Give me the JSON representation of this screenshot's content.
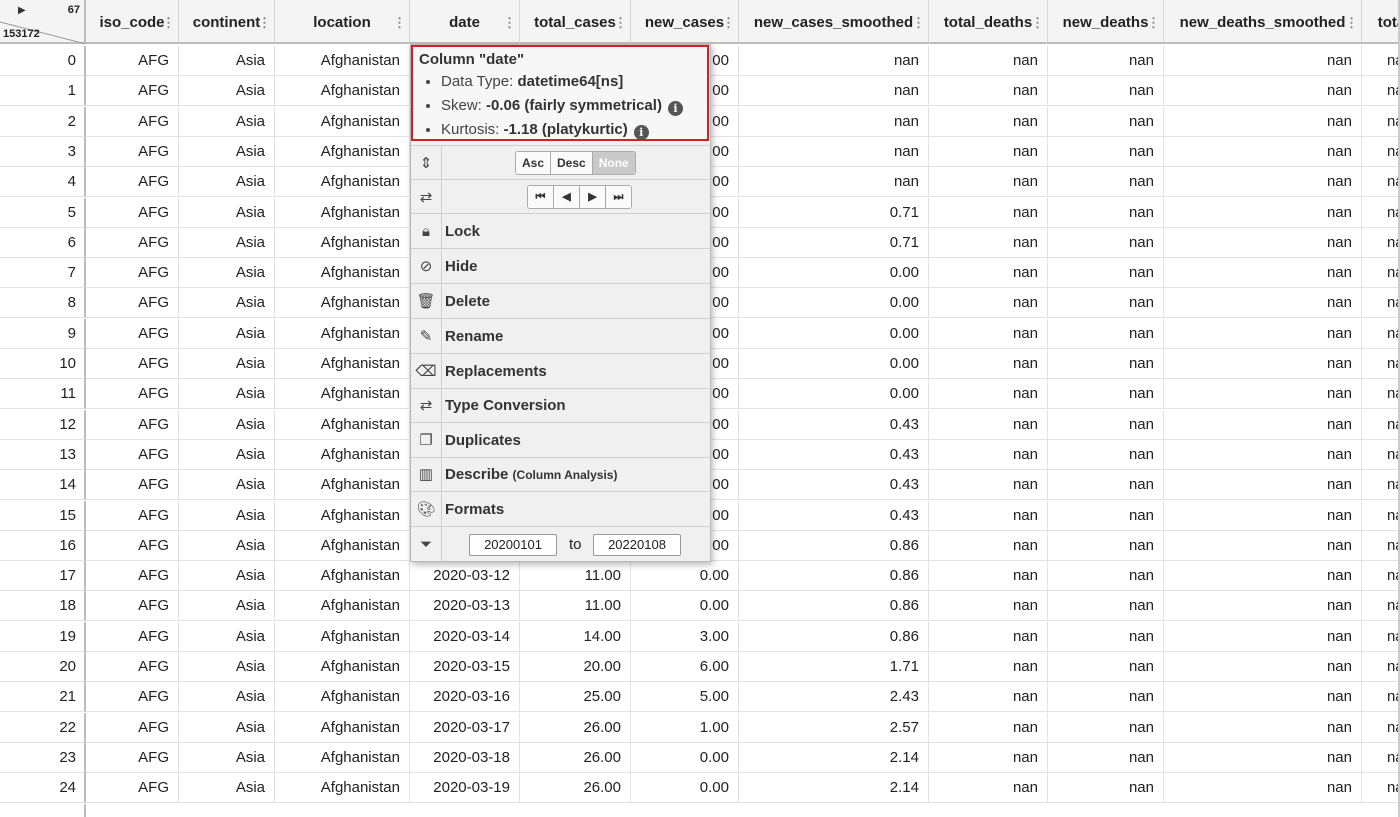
{
  "corner": {
    "col_count": "67",
    "row_count": "153172"
  },
  "columns": [
    "iso_code",
    "continent",
    "location",
    "date",
    "total_cases",
    "new_cases",
    "new_cases_smoothed",
    "total_deaths",
    "new_deaths",
    "new_deaths_smoothed",
    "tota"
  ],
  "rows": [
    {
      "idx": "0",
      "iso": "AFG",
      "cont": "Asia",
      "loc": "Afghanistan",
      "date": "",
      "tc": "",
      "nc": ".00",
      "ncs": "nan",
      "td": "nan",
      "nd": "nan",
      "nds": "nan",
      "t": "nan"
    },
    {
      "idx": "1",
      "iso": "AFG",
      "cont": "Asia",
      "loc": "Afghanistan",
      "date": "",
      "tc": "",
      "nc": ".00",
      "ncs": "nan",
      "td": "nan",
      "nd": "nan",
      "nds": "nan",
      "t": "nan"
    },
    {
      "idx": "2",
      "iso": "AFG",
      "cont": "Asia",
      "loc": "Afghanistan",
      "date": "",
      "tc": "",
      "nc": ".00",
      "ncs": "nan",
      "td": "nan",
      "nd": "nan",
      "nds": "nan",
      "t": "nan"
    },
    {
      "idx": "3",
      "iso": "AFG",
      "cont": "Asia",
      "loc": "Afghanistan",
      "date": "",
      "tc": "",
      "nc": ".00",
      "ncs": "nan",
      "td": "nan",
      "nd": "nan",
      "nds": "nan",
      "t": "nan"
    },
    {
      "idx": "4",
      "iso": "AFG",
      "cont": "Asia",
      "loc": "Afghanistan",
      "date": "",
      "tc": "",
      "nc": ".00",
      "ncs": "nan",
      "td": "nan",
      "nd": "nan",
      "nds": "nan",
      "t": "nan"
    },
    {
      "idx": "5",
      "iso": "AFG",
      "cont": "Asia",
      "loc": "Afghanistan",
      "date": "",
      "tc": "",
      "nc": ".00",
      "ncs": "0.71",
      "td": "nan",
      "nd": "nan",
      "nds": "nan",
      "t": "nan"
    },
    {
      "idx": "6",
      "iso": "AFG",
      "cont": "Asia",
      "loc": "Afghanistan",
      "date": "",
      "tc": "",
      "nc": ".00",
      "ncs": "0.71",
      "td": "nan",
      "nd": "nan",
      "nds": "nan",
      "t": "nan"
    },
    {
      "idx": "7",
      "iso": "AFG",
      "cont": "Asia",
      "loc": "Afghanistan",
      "date": "",
      "tc": "",
      "nc": ".00",
      "ncs": "0.00",
      "td": "nan",
      "nd": "nan",
      "nds": "nan",
      "t": "nan"
    },
    {
      "idx": "8",
      "iso": "AFG",
      "cont": "Asia",
      "loc": "Afghanistan",
      "date": "",
      "tc": "",
      "nc": ".00",
      "ncs": "0.00",
      "td": "nan",
      "nd": "nan",
      "nds": "nan",
      "t": "nan"
    },
    {
      "idx": "9",
      "iso": "AFG",
      "cont": "Asia",
      "loc": "Afghanistan",
      "date": "",
      "tc": "",
      "nc": ".00",
      "ncs": "0.00",
      "td": "nan",
      "nd": "nan",
      "nds": "nan",
      "t": "nan"
    },
    {
      "idx": "10",
      "iso": "AFG",
      "cont": "Asia",
      "loc": "Afghanistan",
      "date": "",
      "tc": "",
      "nc": ".00",
      "ncs": "0.00",
      "td": "nan",
      "nd": "nan",
      "nds": "nan",
      "t": "nan"
    },
    {
      "idx": "11",
      "iso": "AFG",
      "cont": "Asia",
      "loc": "Afghanistan",
      "date": "",
      "tc": "",
      "nc": ".00",
      "ncs": "0.00",
      "td": "nan",
      "nd": "nan",
      "nds": "nan",
      "t": "nan"
    },
    {
      "idx": "12",
      "iso": "AFG",
      "cont": "Asia",
      "loc": "Afghanistan",
      "date": "",
      "tc": "",
      "nc": ".00",
      "ncs": "0.43",
      "td": "nan",
      "nd": "nan",
      "nds": "nan",
      "t": "nan"
    },
    {
      "idx": "13",
      "iso": "AFG",
      "cont": "Asia",
      "loc": "Afghanistan",
      "date": "",
      "tc": "",
      "nc": ".00",
      "ncs": "0.43",
      "td": "nan",
      "nd": "nan",
      "nds": "nan",
      "t": "nan"
    },
    {
      "idx": "14",
      "iso": "AFG",
      "cont": "Asia",
      "loc": "Afghanistan",
      "date": "",
      "tc": "",
      "nc": ".00",
      "ncs": "0.43",
      "td": "nan",
      "nd": "nan",
      "nds": "nan",
      "t": "nan"
    },
    {
      "idx": "15",
      "iso": "AFG",
      "cont": "Asia",
      "loc": "Afghanistan",
      "date": "",
      "tc": "",
      "nc": ".00",
      "ncs": "0.43",
      "td": "nan",
      "nd": "nan",
      "nds": "nan",
      "t": "nan"
    },
    {
      "idx": "16",
      "iso": "AFG",
      "cont": "Asia",
      "loc": "Afghanistan",
      "date": "",
      "tc": "",
      "nc": ".00",
      "ncs": "0.86",
      "td": "nan",
      "nd": "nan",
      "nds": "nan",
      "t": "nan"
    },
    {
      "idx": "17",
      "iso": "AFG",
      "cont": "Asia",
      "loc": "Afghanistan",
      "date": "2020-03-12",
      "tc": "11.00",
      "nc": "0.00",
      "ncs": "0.86",
      "td": "nan",
      "nd": "nan",
      "nds": "nan",
      "t": "nan"
    },
    {
      "idx": "18",
      "iso": "AFG",
      "cont": "Asia",
      "loc": "Afghanistan",
      "date": "2020-03-13",
      "tc": "11.00",
      "nc": "0.00",
      "ncs": "0.86",
      "td": "nan",
      "nd": "nan",
      "nds": "nan",
      "t": "nan"
    },
    {
      "idx": "19",
      "iso": "AFG",
      "cont": "Asia",
      "loc": "Afghanistan",
      "date": "2020-03-14",
      "tc": "14.00",
      "nc": "3.00",
      "ncs": "0.86",
      "td": "nan",
      "nd": "nan",
      "nds": "nan",
      "t": "nan"
    },
    {
      "idx": "20",
      "iso": "AFG",
      "cont": "Asia",
      "loc": "Afghanistan",
      "date": "2020-03-15",
      "tc": "20.00",
      "nc": "6.00",
      "ncs": "1.71",
      "td": "nan",
      "nd": "nan",
      "nds": "nan",
      "t": "nan"
    },
    {
      "idx": "21",
      "iso": "AFG",
      "cont": "Asia",
      "loc": "Afghanistan",
      "date": "2020-03-16",
      "tc": "25.00",
      "nc": "5.00",
      "ncs": "2.43",
      "td": "nan",
      "nd": "nan",
      "nds": "nan",
      "t": "nan"
    },
    {
      "idx": "22",
      "iso": "AFG",
      "cont": "Asia",
      "loc": "Afghanistan",
      "date": "2020-03-17",
      "tc": "26.00",
      "nc": "1.00",
      "ncs": "2.57",
      "td": "nan",
      "nd": "nan",
      "nds": "nan",
      "t": "nan"
    },
    {
      "idx": "23",
      "iso": "AFG",
      "cont": "Asia",
      "loc": "Afghanistan",
      "date": "2020-03-18",
      "tc": "26.00",
      "nc": "0.00",
      "ncs": "2.14",
      "td": "nan",
      "nd": "nan",
      "nds": "nan",
      "t": "nan"
    },
    {
      "idx": "24",
      "iso": "AFG",
      "cont": "Asia",
      "loc": "Afghanistan",
      "date": "2020-03-19",
      "tc": "26.00",
      "nc": "0.00",
      "ncs": "2.14",
      "td": "nan",
      "nd": "nan",
      "nds": "nan",
      "t": "nan"
    }
  ],
  "menu": {
    "info_title": "Column \"date\"",
    "dtype_label": "Data Type: ",
    "dtype_value": "datetime64[ns]",
    "skew_label": "Skew: ",
    "skew_value": "-0.06 (fairly symmetrical)",
    "kurt_label": "Kurtosis: ",
    "kurt_value": "-1.18 (platykurtic)",
    "sort_asc": "Asc",
    "sort_desc": "Desc",
    "sort_none": "None",
    "lock": "Lock",
    "hide": "Hide",
    "delete": "Delete",
    "rename": "Rename",
    "replacements": "Replacements",
    "type_conversion": "Type Conversion",
    "duplicates": "Duplicates",
    "describe": "Describe",
    "describe_sub": "(Column Analysis)",
    "formats": "Formats",
    "filter_from": "20200101",
    "filter_to_label": "to",
    "filter_to": "20220108"
  }
}
